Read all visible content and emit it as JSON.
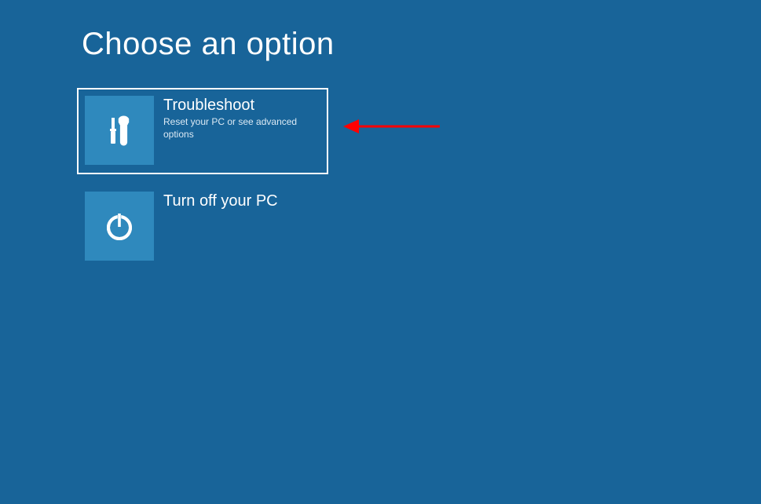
{
  "page": {
    "title": "Choose an option"
  },
  "options": [
    {
      "title": "Troubleshoot",
      "subtitle": "Reset your PC or see advanced options",
      "icon": "tools-icon",
      "selected": true
    },
    {
      "title": "Turn off your PC",
      "subtitle": "",
      "icon": "power-icon",
      "selected": false
    }
  ],
  "annotation": {
    "type": "arrow",
    "color": "#FF0000",
    "points_to": "troubleshoot"
  }
}
